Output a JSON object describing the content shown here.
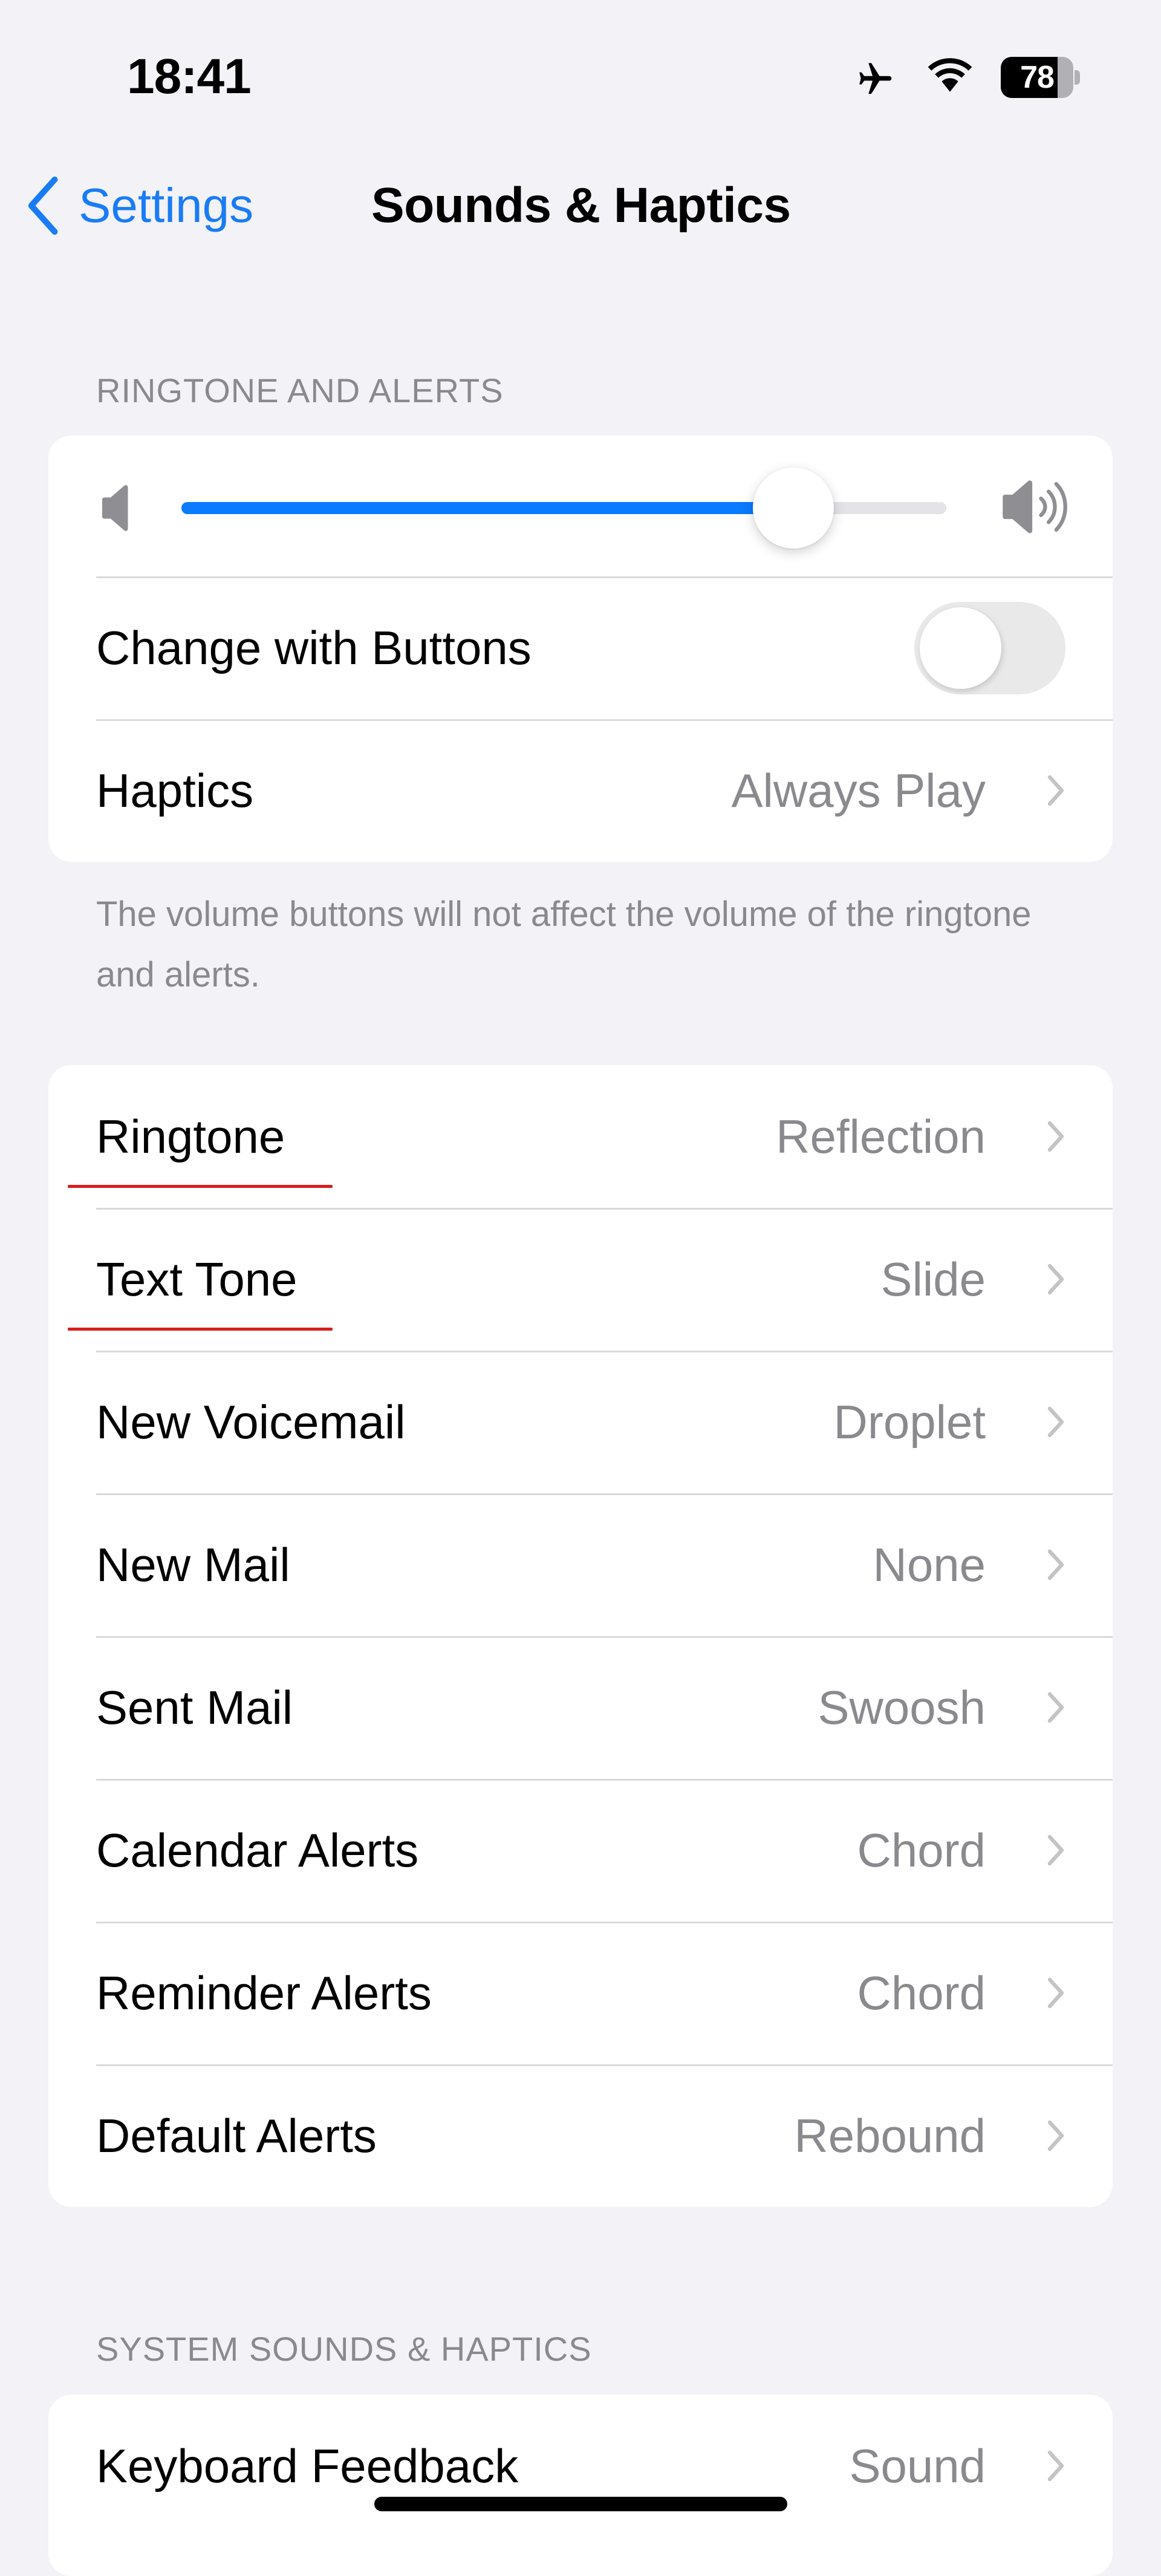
{
  "status_bar": {
    "time": "18:41",
    "battery_percent": "78",
    "battery_level": 0.78,
    "icons": [
      "airplane-mode-icon",
      "wifi-icon",
      "battery-icon"
    ]
  },
  "nav": {
    "back_label": "Settings",
    "title": "Sounds & Haptics"
  },
  "colors": {
    "accent": "#0a7aff",
    "annotation_red": "#d81e1e",
    "secondary_text": "#8a8a8e",
    "background": "#f2f2f7"
  },
  "ringtone_alerts": {
    "header": "RINGTONE AND ALERTS",
    "volume": {
      "value": 0.8,
      "low_icon": "speaker-low-icon",
      "high_icon": "speaker-high-icon"
    },
    "change_with_buttons": {
      "label": "Change with Buttons",
      "on": false
    },
    "haptics": {
      "label": "Haptics",
      "value": "Always Play"
    },
    "footer": "The volume buttons will not affect the volume of the ringtone and alerts."
  },
  "tones": {
    "rows": [
      {
        "label": "Ringtone",
        "value": "Reflection",
        "annotated": true
      },
      {
        "label": "Text Tone",
        "value": "Slide",
        "annotated": true
      },
      {
        "label": "New Voicemail",
        "value": "Droplet",
        "annotated": false
      },
      {
        "label": "New Mail",
        "value": "None",
        "annotated": false
      },
      {
        "label": "Sent Mail",
        "value": "Swoosh",
        "annotated": false
      },
      {
        "label": "Calendar Alerts",
        "value": "Chord",
        "annotated": false
      },
      {
        "label": "Reminder Alerts",
        "value": "Chord",
        "annotated": false
      },
      {
        "label": "Default Alerts",
        "value": "Rebound",
        "annotated": false
      }
    ]
  },
  "system_sounds": {
    "header": "SYSTEM SOUNDS & HAPTICS",
    "rows": [
      {
        "label": "Keyboard Feedback",
        "value": "Sound"
      }
    ]
  }
}
